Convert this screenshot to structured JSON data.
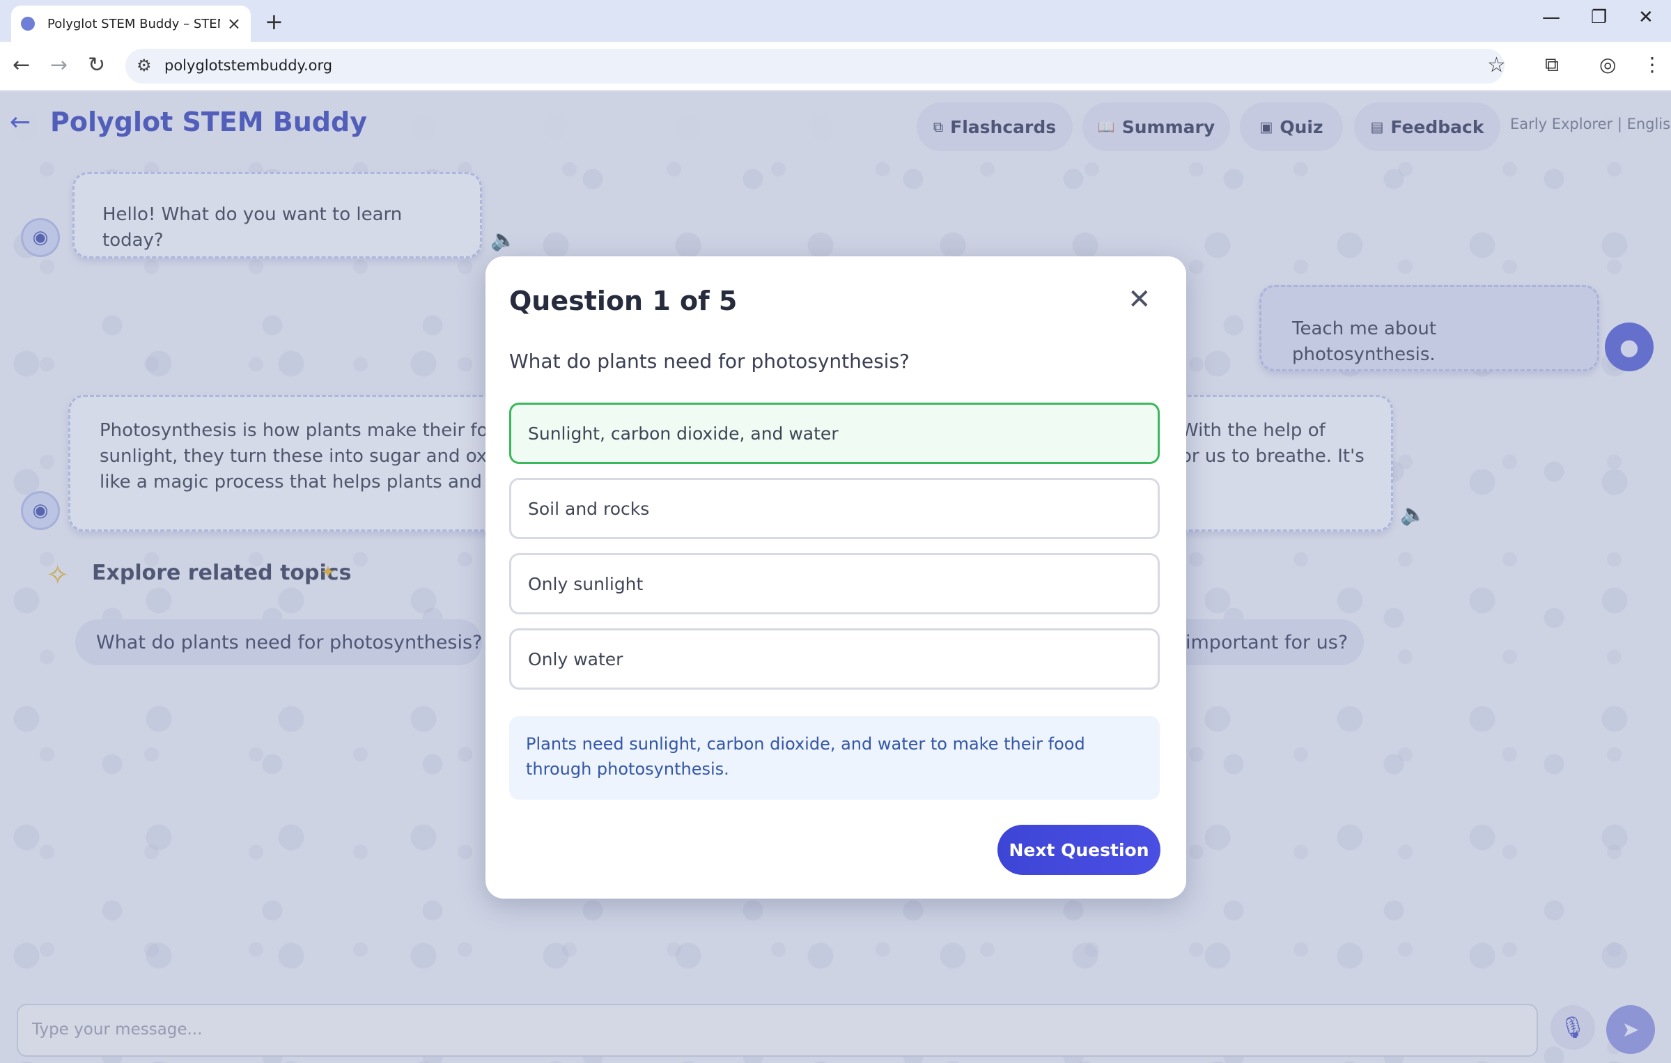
{
  "browser": {
    "tab_title": "Polyglot STEM Buddy – STEM le",
    "url": "polyglotstembuddy.org"
  },
  "header": {
    "brand": "Polyglot STEM Buddy",
    "nav": [
      {
        "label": "Flashcards",
        "icon": "cards-icon"
      },
      {
        "label": "Summary",
        "icon": "book-icon"
      },
      {
        "label": "Quiz",
        "icon": "clipboard-icon"
      },
      {
        "label": "Feedback",
        "icon": "form-icon"
      }
    ],
    "level_language": "Early Explorer | English"
  },
  "chat": {
    "bot_greeting": "Hello! What do you want to learn today?",
    "user_message": "Teach me about photosynthesis.",
    "bot_answer_left": "Photosynthesis is how plants make their food\nsunlight, they turn these into sugar and oxyge\nlike a magic process that helps plants and giv",
    "bot_answer_right": "With the help of\nor us to breathe. It's"
  },
  "explore": {
    "title": "Explore related topics",
    "chips": [
      "What do plants need for photosynthesis?",
      "important for us?"
    ]
  },
  "composer": {
    "placeholder": "Type your message..."
  },
  "quiz": {
    "title": "Question 1 of 5",
    "question": "What do plants need for photosynthesis?",
    "options": [
      {
        "label": "Sunlight, carbon dioxide, and water",
        "state": "correct"
      },
      {
        "label": "Soil and rocks",
        "state": "default"
      },
      {
        "label": "Only sunlight",
        "state": "default"
      },
      {
        "label": "Only water",
        "state": "default"
      }
    ],
    "explanation": "Plants need sunlight, carbon dioxide, and water to make their food through photosynthesis.",
    "next_label": "Next Question"
  },
  "colors": {
    "brand": "#3240b8",
    "correct_border": "#3bb85d",
    "primary_button": "#3d45d6"
  }
}
